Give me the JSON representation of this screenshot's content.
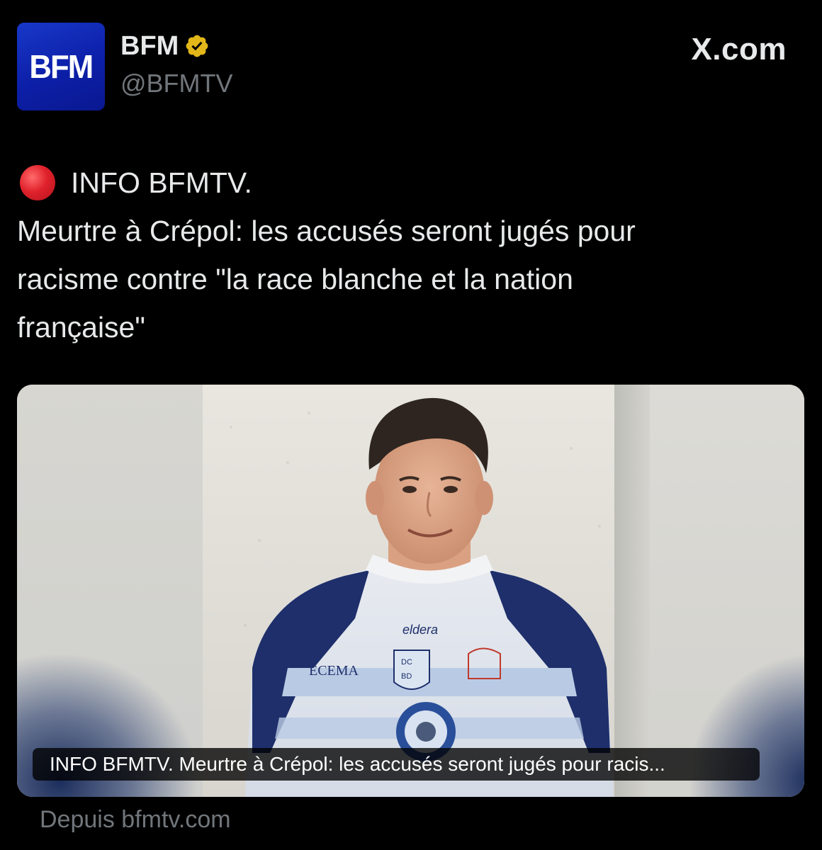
{
  "header": {
    "avatar_text": "BFM",
    "display_name": "BFM",
    "handle": "@BFMTV",
    "source_brand": "X.com"
  },
  "tweet": {
    "line1": "INFO BFMTV.",
    "line2": "Meurtre à Crépol: les accusés seront jugés pour",
    "line3": "racisme contre \"la race blanche et la nation",
    "line4": "française\""
  },
  "media": {
    "caption": "INFO BFMTV. Meurtre à Crépol: les accusés seront jugés pour racis...",
    "jersey_texts": [
      "eldera",
      "ECEMA",
      "DC",
      "BD"
    ]
  },
  "footer": {
    "from_source": "Depuis bfmtv.com"
  },
  "colors": {
    "background": "#000000",
    "text_primary": "#e7e9ea",
    "text_secondary": "#71767b",
    "avatar_blue": "#1230b8",
    "verified_gold": "#e2b719",
    "jersey_navy": "#1e2f6b",
    "jersey_light": "#c9d7ea"
  }
}
